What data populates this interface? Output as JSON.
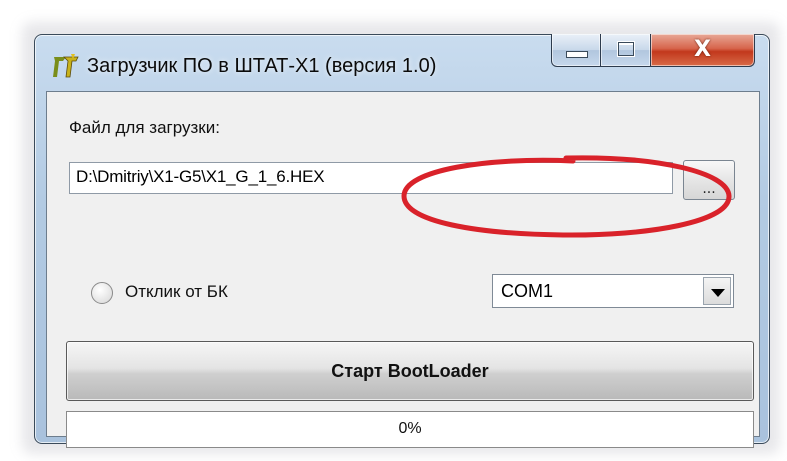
{
  "window": {
    "title": "Загрузчик ПО в ШТАТ-Х1 (версия 1.0)",
    "icon": "app-logo-icon",
    "caption_buttons": {
      "minimize_icon": "minimize-icon",
      "maximize_icon": "maximize-icon",
      "close_icon": "close-icon",
      "close_glyph": "X"
    }
  },
  "form": {
    "file_label": "Файл для загрузки:",
    "file_path": "D:\\Dmitriy\\X1-G5\\X1_G_1_6.HEX",
    "browse_label": "...",
    "radio_label": "Отклик от БК",
    "radio_checked": false,
    "port_selected": "COM1",
    "start_label": "Старт BootLoader",
    "progress_percent": 0,
    "progress_text": "0%"
  },
  "colors": {
    "annotation_red": "#d9222a",
    "close_red": "#c2381c",
    "progress_green": "#3bb03b"
  }
}
